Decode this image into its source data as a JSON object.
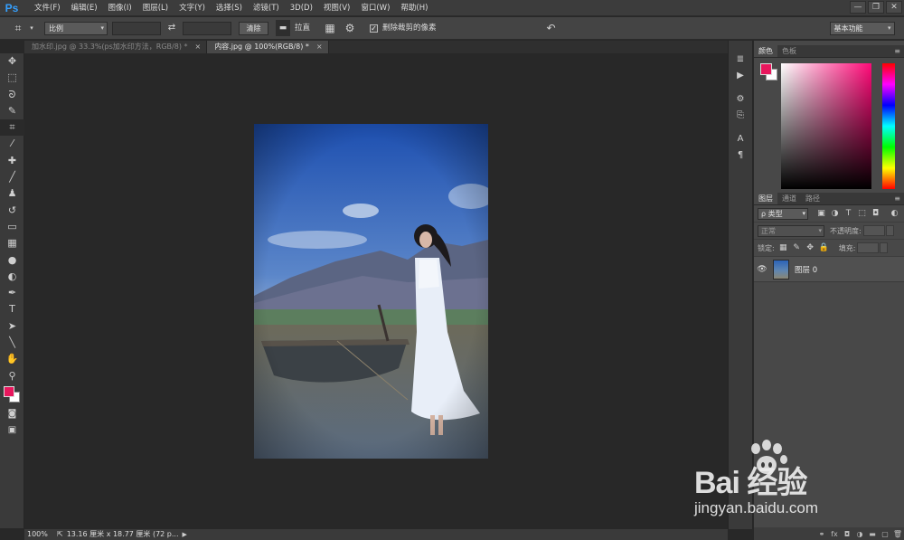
{
  "app": {
    "logo": "Ps",
    "menus": [
      "文件(F)",
      "编辑(E)",
      "图像(I)",
      "图层(L)",
      "文字(Y)",
      "选择(S)",
      "滤镜(T)",
      "3D(D)",
      "视图(V)",
      "窗口(W)",
      "帮助(H)"
    ],
    "window_controls": [
      "—",
      "❐",
      "✕"
    ]
  },
  "options_bar": {
    "crop_icon": "crop-icon",
    "ratio_select": "比例",
    "clear_button": "清除",
    "straighten_label": "拉直",
    "delete_cropped_label": "删除裁剪的像素",
    "delete_cropped_checked": true,
    "workspace_select": "基本功能"
  },
  "tabs": [
    {
      "label": "加水印.jpg @ 33.3%(ps加水印方法，RGB/8) *",
      "active": false,
      "close": "×"
    },
    {
      "label": "内容.jpg @ 100%(RGB/8) *",
      "active": true,
      "close": "×"
    }
  ],
  "toolbar": {
    "tools": [
      {
        "name": "move-tool",
        "glyph": "✥"
      },
      {
        "name": "marquee-tool",
        "glyph": "⬚"
      },
      {
        "name": "lasso-tool",
        "glyph": "ᘐ"
      },
      {
        "name": "quick-select-tool",
        "glyph": "✎"
      },
      {
        "name": "crop-tool",
        "glyph": "⌗",
        "active": true
      },
      {
        "name": "eyedropper-tool",
        "glyph": "⁄"
      },
      {
        "name": "healing-brush-tool",
        "glyph": "✚"
      },
      {
        "name": "brush-tool",
        "glyph": "╱"
      },
      {
        "name": "clone-stamp-tool",
        "glyph": "♟"
      },
      {
        "name": "history-brush-tool",
        "glyph": "↺"
      },
      {
        "name": "eraser-tool",
        "glyph": "▭"
      },
      {
        "name": "gradient-tool",
        "glyph": "▦"
      },
      {
        "name": "blur-tool",
        "glyph": "●"
      },
      {
        "name": "dodge-tool",
        "glyph": "◐"
      },
      {
        "name": "pen-tool",
        "glyph": "✒"
      },
      {
        "name": "type-tool",
        "glyph": "T"
      },
      {
        "name": "path-select-tool",
        "glyph": "➤"
      },
      {
        "name": "line-tool",
        "glyph": "╲"
      },
      {
        "name": "hand-tool",
        "glyph": "✋"
      },
      {
        "name": "zoom-tool",
        "glyph": "⚲"
      }
    ],
    "fg_color": "#e8175d",
    "bg_color": "#ffffff",
    "quick_mask_glyph": "◙",
    "screen_mode_glyph": "▣"
  },
  "icon_strip": [
    {
      "name": "history-icon",
      "glyph": "≣"
    },
    {
      "name": "actions-play-icon",
      "glyph": "▶"
    },
    {
      "name": "brush-presets-icon",
      "glyph": "⚙"
    },
    {
      "name": "clone-source-icon",
      "glyph": "⎘"
    },
    {
      "name": "character-icon",
      "glyph": "A"
    },
    {
      "name": "paragraph-icon",
      "glyph": "¶"
    }
  ],
  "color_panel": {
    "tabs": [
      "颜色",
      "色板"
    ],
    "fg_color": "#e8175d",
    "bg_color": "#ffffff",
    "hue_color": "#ff0a78"
  },
  "layers_panel": {
    "tabs": [
      "图层",
      "通道",
      "路径"
    ],
    "filter_select": "ρ 类型",
    "blend_mode": "正常",
    "opacity_label": "不透明度:",
    "lock_label": "锁定:",
    "fill_label": "填充:",
    "layer_name": "图层 0",
    "eye_glyph": "👁",
    "footer_icons": [
      "⚭",
      "fx",
      "◘",
      "◑",
      "▬",
      "▢",
      "🗑"
    ]
  },
  "status_bar": {
    "zoom": "100%",
    "doc_info": "13.16 厘米 x 18.77 厘米 (72 p...",
    "arrow": "▶"
  },
  "watermark": {
    "line1": "Bai 经验",
    "line2": "jingyan.baidu.com"
  }
}
